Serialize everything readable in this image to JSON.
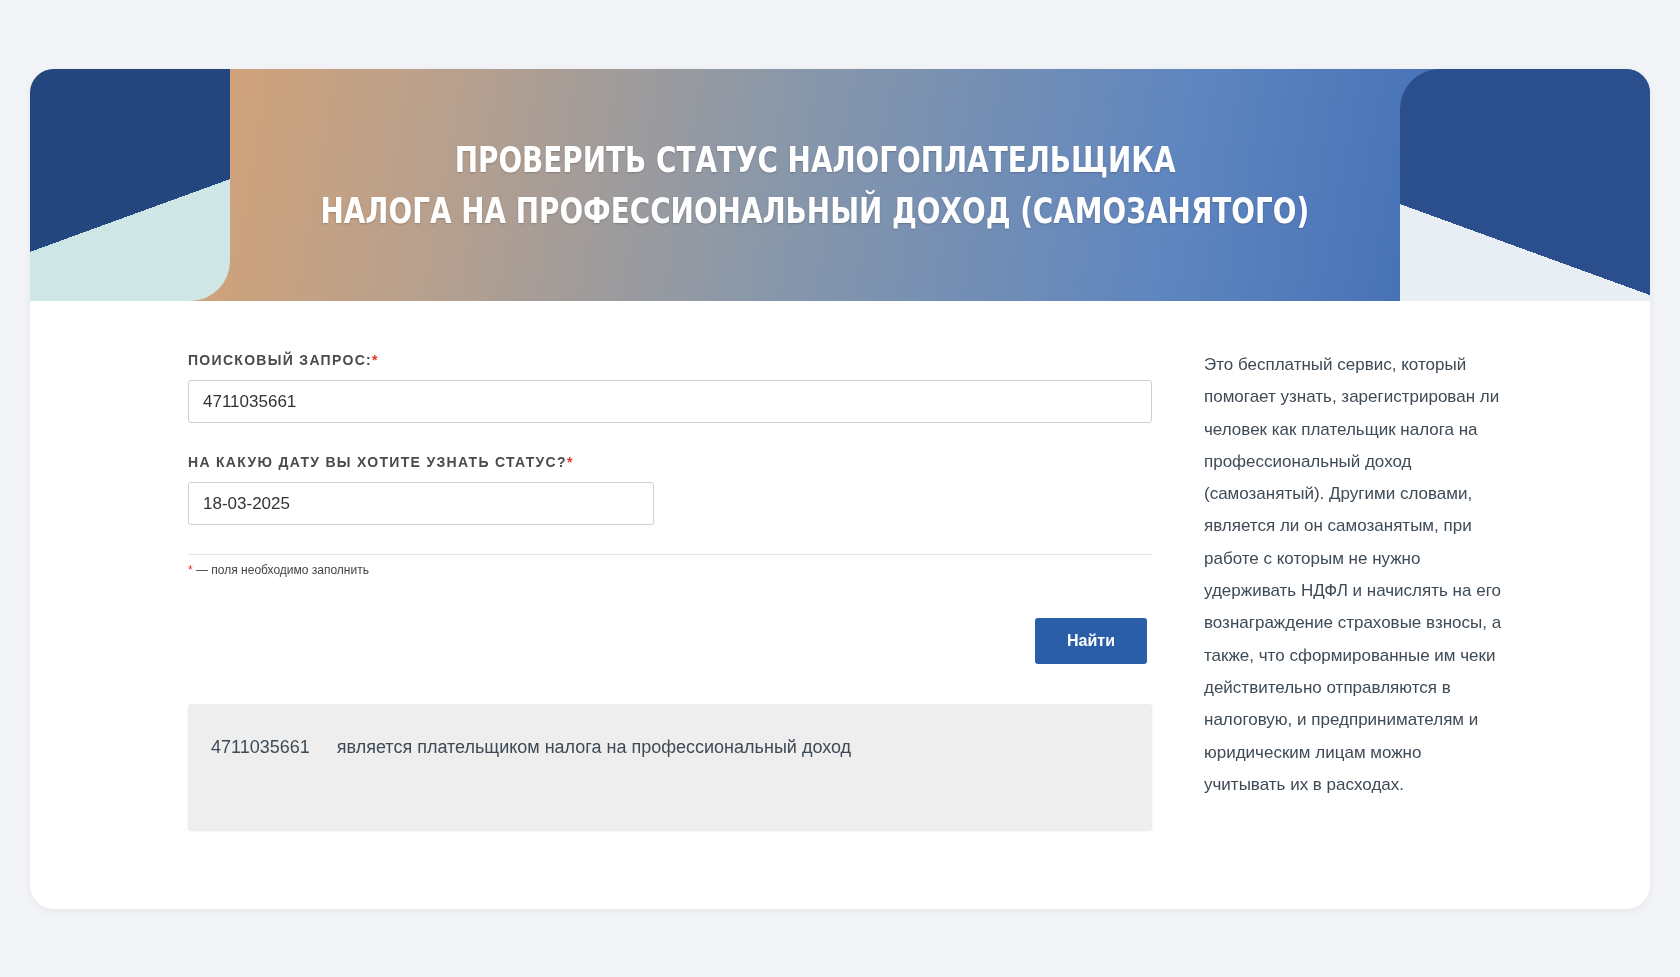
{
  "banner": {
    "title_lines": [
      "ПРОВЕРИТЬ СТАТУС НАЛОГОПЛАТЕЛЬЩИКА",
      "НАЛОГА НА ПРОФЕССИОНАЛЬНЫЙ ДОХОД (САМОЗАНЯТОГО)"
    ]
  },
  "form": {
    "fields": [
      {
        "label": "ПОИСКОВЫЙ ЗАПРОС:",
        "required_mark": "*",
        "value": "4711035661",
        "kind": "wide"
      },
      {
        "label": "НА КАКУЮ ДАТУ ВЫ ХОТИТЕ УЗНАТЬ СТАТУС?",
        "required_mark": "*",
        "value": "18-03-2025",
        "kind": "narrow"
      }
    ],
    "note": {
      "mark": "*",
      "text": "— поля необходимо заполнить"
    },
    "submit": "Найти"
  },
  "result": {
    "inn": "4711035661",
    "message": "является плательщиком налога на профессиональный доход"
  },
  "description": "Это бесплатный сервис, который помогает узнать, зарегистрирован ли человек как плательщик налога на профессиональный доход (самозанятый). Другими словами, является ли он самозанятым, при работе с которым не нужно удерживать НДФЛ и начислять на его вознаграждение страховые взносы, а также, что сформированные им чеки действительно отправляются в налоговую, и предпринимателям и юридическим лицам можно учитывать их в расходах."
}
